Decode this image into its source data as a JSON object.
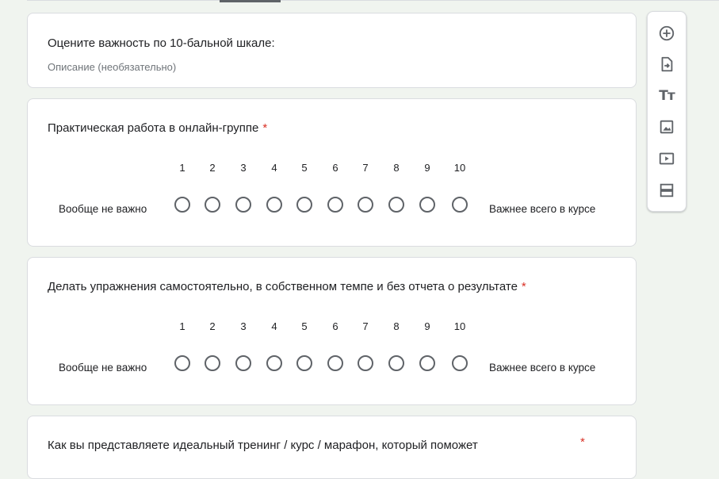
{
  "section": {
    "title": "Оцените важность по 10-бальной шкале:",
    "description_placeholder": "Описание (необязательно)"
  },
  "questions": [
    {
      "title": "Практическая работа в онлайн-группе",
      "required_mark": "*",
      "scale_numbers": [
        "1",
        "2",
        "3",
        "4",
        "5",
        "6",
        "7",
        "8",
        "9",
        "10"
      ],
      "min_label": "Вообще не важно",
      "max_label": "Важнее всего в курсе"
    },
    {
      "title": "Делать упражнения самостоятельно, в собственном темпе и без отчета о результате",
      "required_mark": "*",
      "scale_numbers": [
        "1",
        "2",
        "3",
        "4",
        "5",
        "6",
        "7",
        "8",
        "9",
        "10"
      ],
      "min_label": "Вообще не важно",
      "max_label": "Важнее всего в курсе"
    },
    {
      "title": "Как вы представляете идеальный тренинг / курс / марафон, который поможет",
      "required_mark": "*"
    }
  ],
  "toolbar": {
    "items": [
      "add-question-icon",
      "import-questions-icon",
      "add-title-icon",
      "add-image-icon",
      "add-video-icon",
      "add-section-icon"
    ],
    "title_glyph": "Tт"
  },
  "colors": {
    "background": "#f0f4ef",
    "required": "#d93025",
    "icon": "#5f6368"
  }
}
